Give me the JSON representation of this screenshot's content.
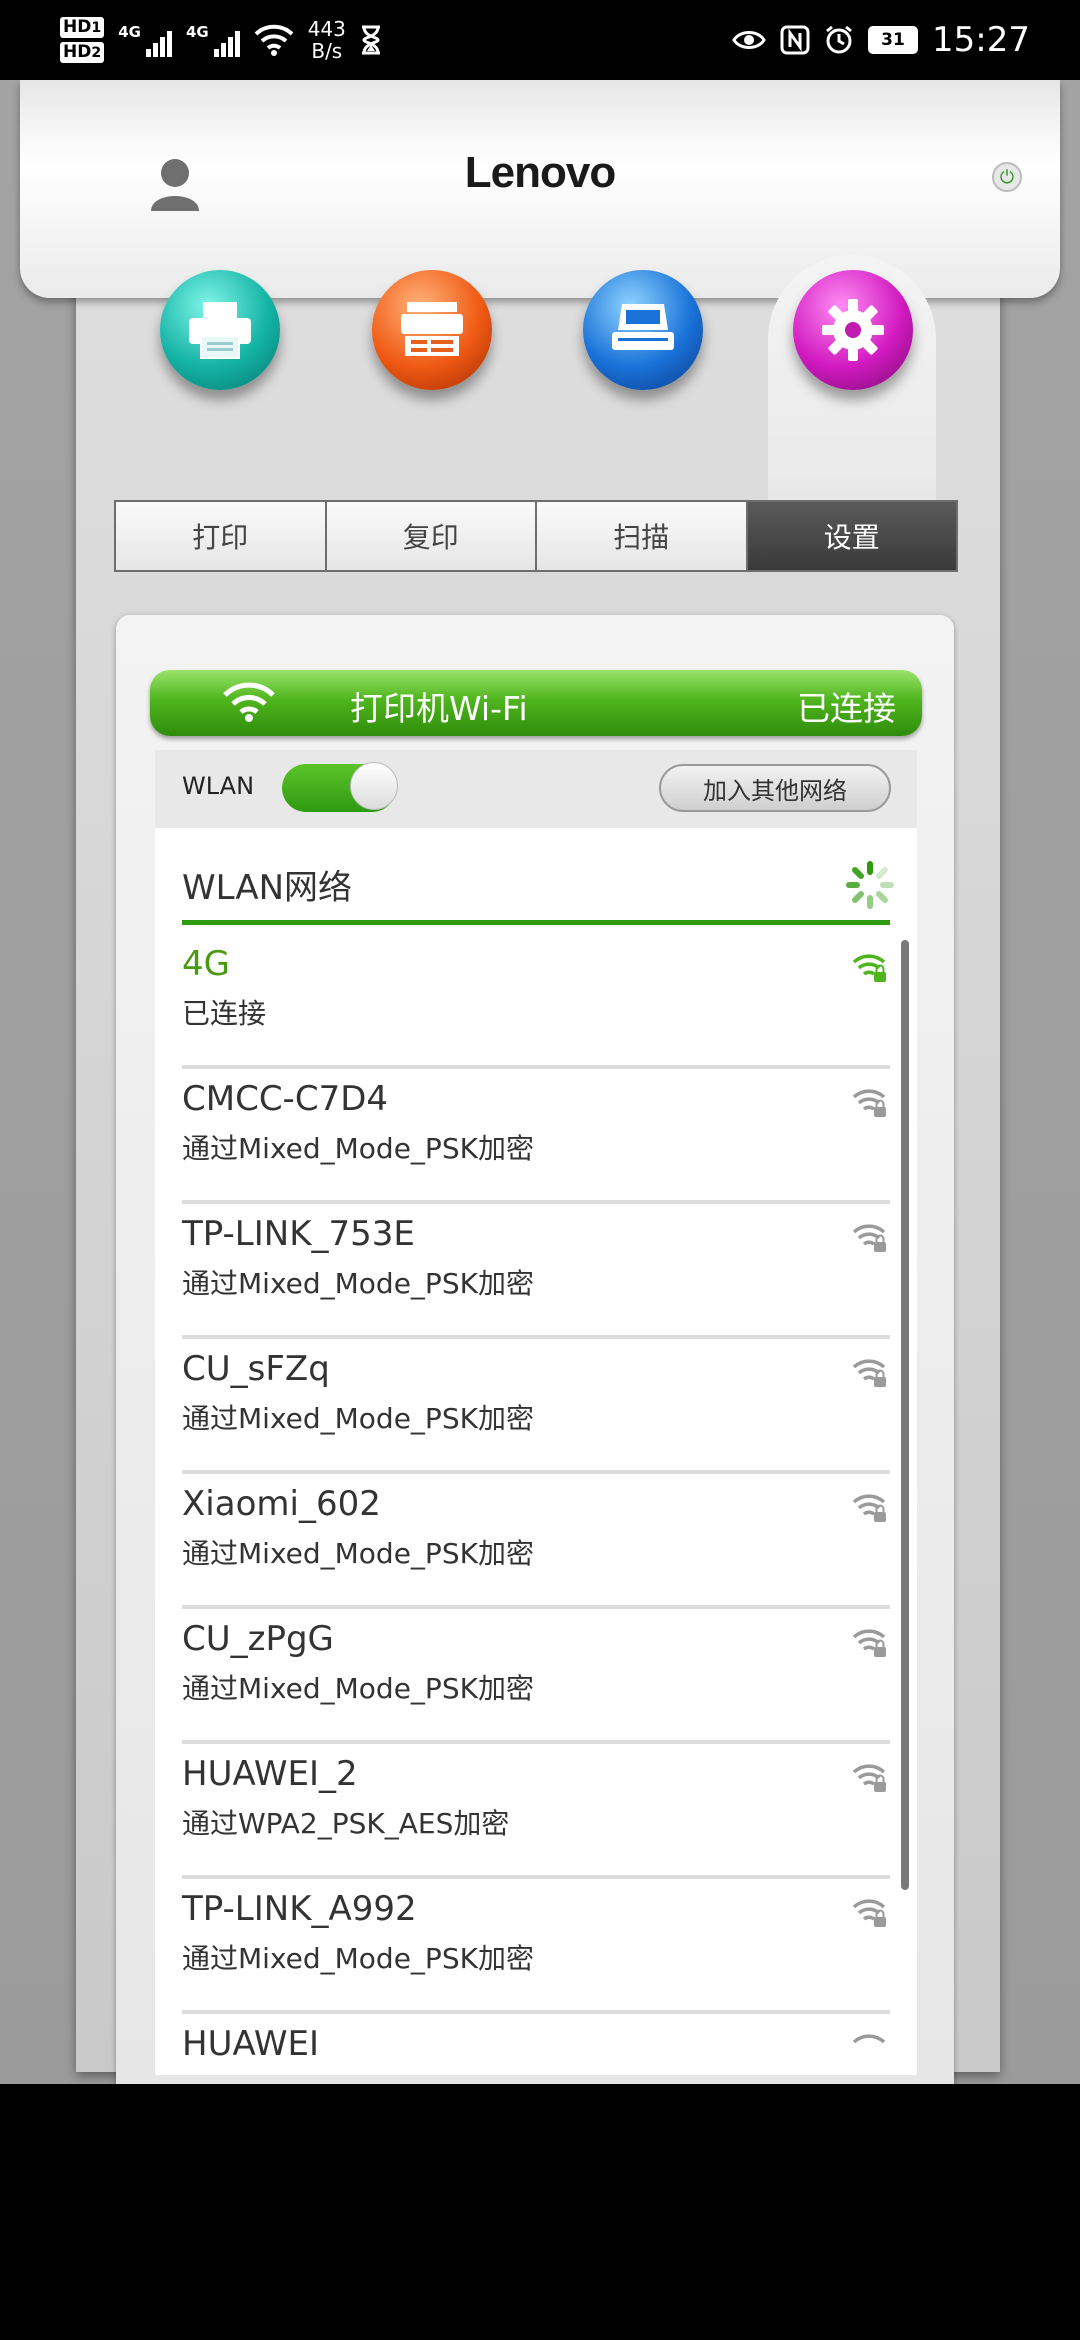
{
  "status_bar": {
    "hd1": "HD",
    "hd1_sub": "1",
    "hd2": "HD",
    "hd2_sub": "2",
    "net1": "4G",
    "net2": "4G",
    "speed_value": "443",
    "speed_unit": "B/s",
    "battery": "31",
    "time": "15:27",
    "icons": [
      "eye-icon",
      "nfc-icon",
      "alarm-icon",
      "hourglass-icon"
    ]
  },
  "header": {
    "brand": "Lenovo",
    "icons": [
      "user-icon",
      "power-icon"
    ]
  },
  "modes": {
    "icons": [
      "printer-icon",
      "copier-icon",
      "scanner-icon",
      "gear-icon"
    ]
  },
  "tabs": [
    {
      "label": "打印",
      "active": false
    },
    {
      "label": "复印",
      "active": false
    },
    {
      "label": "扫描",
      "active": false
    },
    {
      "label": "设置",
      "active": true
    }
  ],
  "wifi_card": {
    "title": "打印机Wi-Fi",
    "status": "已连接",
    "wlan_label": "WLAN",
    "wlan_enabled": true,
    "join_other": "加入其他网络",
    "section_title": "WLAN网络",
    "networks": [
      {
        "name": "4G",
        "detail": "已连接",
        "connected": true
      },
      {
        "name": "CMCC-C7D4",
        "detail": "通过Mixed_Mode_PSK加密",
        "connected": false
      },
      {
        "name": "TP-LINK_753E",
        "detail": "通过Mixed_Mode_PSK加密",
        "connected": false
      },
      {
        "name": "CU_sFZq",
        "detail": "通过Mixed_Mode_PSK加密",
        "connected": false
      },
      {
        "name": "Xiaomi_602",
        "detail": "通过Mixed_Mode_PSK加密",
        "connected": false
      },
      {
        "name": "CU_zPgG",
        "detail": "通过Mixed_Mode_PSK加密",
        "connected": false
      },
      {
        "name": "HUAWEI_2",
        "detail": "通过WPA2_PSK_AES加密",
        "connected": false
      },
      {
        "name": "TP-LINK_A992",
        "detail": "通过Mixed_Mode_PSK加密",
        "connected": false
      },
      {
        "name": "HUAWEI",
        "detail": "",
        "connected": false
      }
    ]
  },
  "colors": {
    "accent_green": "#2e9a10",
    "connected_text": "#4a9a10",
    "active_tab": "#4a4a4a"
  }
}
